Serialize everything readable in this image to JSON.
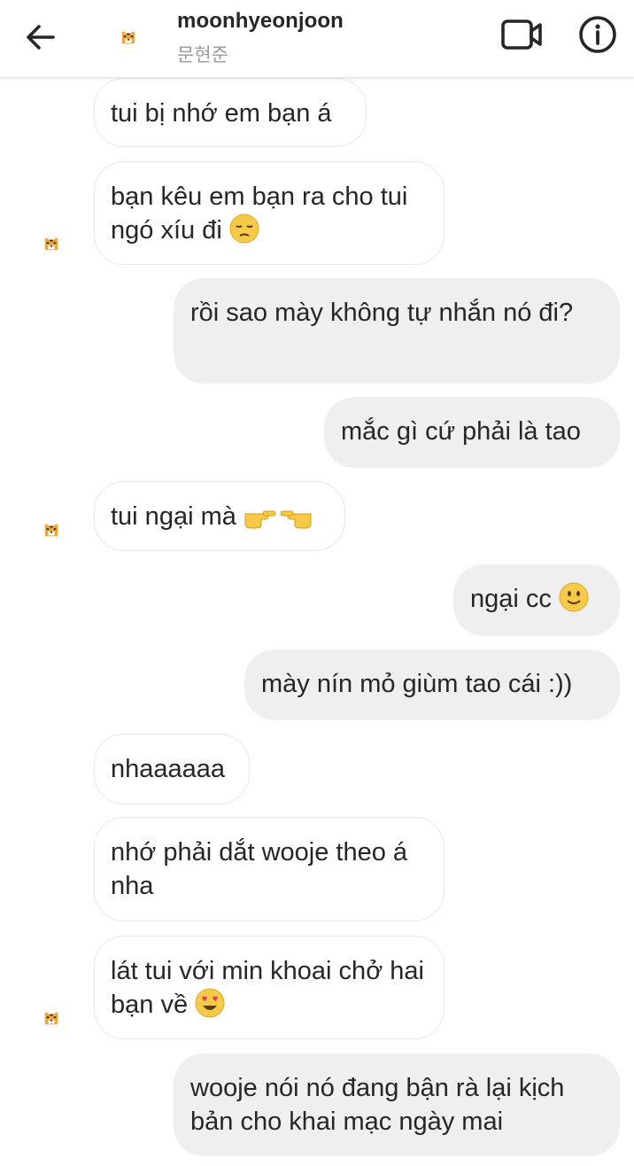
{
  "header": {
    "username": "moonhyeonjoon",
    "subname": "문현준",
    "icons": [
      "back-arrow-icon",
      "avatar",
      "video-call-icon",
      "info-icon"
    ]
  },
  "messages": [
    {
      "direction": "in",
      "text": "tui bị nhớ em bạn á"
    },
    {
      "direction": "in",
      "text": "bạn kêu em bạn ra cho tui ngó xíu đi",
      "emoji": "pensive-face-emoji"
    },
    {
      "direction": "out",
      "text": "rồi sao mày không tự nhắn nó đi?"
    },
    {
      "direction": "out",
      "text": "mắc gì cứ phải là tao"
    },
    {
      "direction": "in",
      "text": "tui ngại mà",
      "emoji": "pointing-hands-emoji"
    },
    {
      "direction": "out",
      "text": "ngại cc",
      "emoji": "slightly-smiling-face-emoji"
    },
    {
      "direction": "out",
      "text": "mày nín mỏ giùm tao cái :))"
    },
    {
      "direction": "in",
      "text": "nhaaaaaa"
    },
    {
      "direction": "in",
      "text": "nhớ phải dắt wooje theo á nha"
    },
    {
      "direction": "in",
      "text": "lát tui với min khoai chở hai bạn về",
      "emoji": "heart-eyes-emoji"
    },
    {
      "direction": "out",
      "text": "wooje nói nó đang bận rà lại kịch bản cho khai mạc ngày mai"
    }
  ],
  "colors": {
    "outgoing_bubble": "#efefef",
    "incoming_border": "#e8e8e8",
    "text": "#262626",
    "subtext": "#9a9a9a"
  }
}
